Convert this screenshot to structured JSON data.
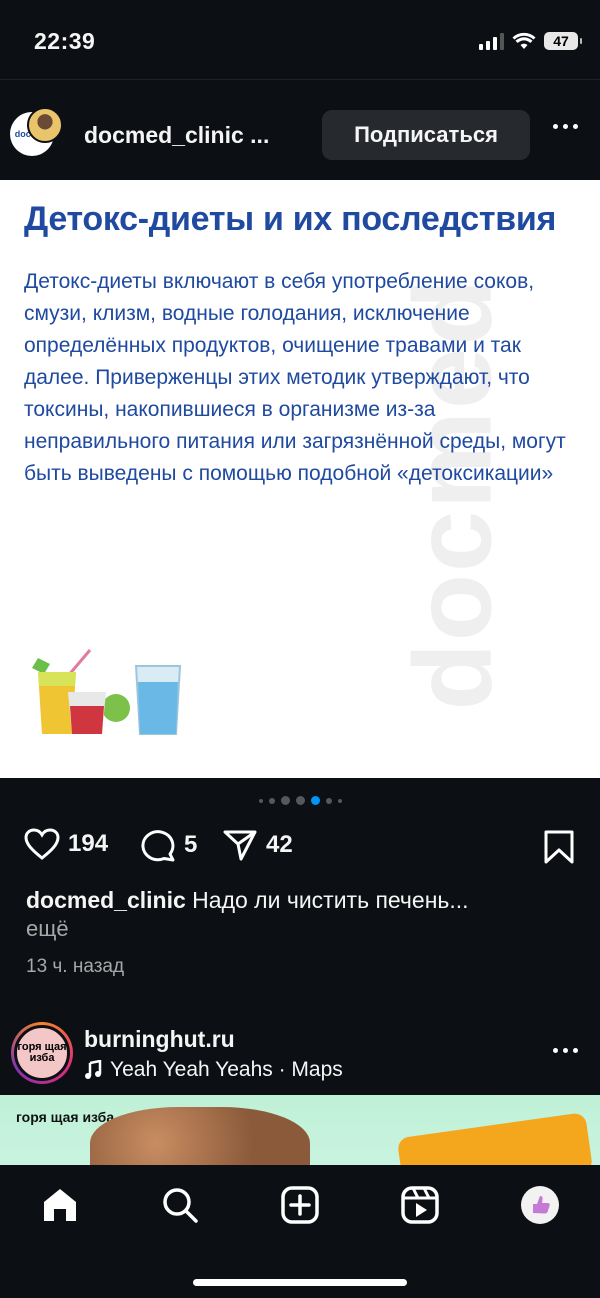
{
  "status_bar": {
    "time": "22:39",
    "battery": "47"
  },
  "post1": {
    "username": "docmed_clinic ...",
    "avatar_text": "docmed",
    "follow_label": "Подписаться",
    "image": {
      "title": "Детокс-диеты и их последствия",
      "body": "Детокс-диеты включают в себя употребление соков, смузи, клизм, водные голодания, исключение определённых продуктов, очищение травами и так далее. Приверженцы этих методик утверждают, что токсины, накопившиеся в организме из-за неправильного питания или загрязнённой среды, могут быть выведены с помощью подобной «детоксикации»",
      "watermark": "docmed"
    },
    "carousel": {
      "count": 7,
      "active": 4
    },
    "likes": "194",
    "comments": "5",
    "shares": "42",
    "caption_user": "docmed_clinic",
    "caption_text": "Надо ли чистить печень...",
    "more": "ещё",
    "time_ago": "13 ч. назад"
  },
  "post2": {
    "username": "burninghut.ru",
    "avatar_text": "горя щая изба",
    "music": "Yeah Yeah Yeahs · Maps",
    "logo_text": "горя щая изба"
  },
  "tabs": [
    "home-icon",
    "search-icon",
    "create-icon",
    "reels-icon",
    "profile-icon"
  ],
  "colors": {
    "accent_blue": "#1f4aa0",
    "background": "#0c1014",
    "button": "#262a2f"
  }
}
